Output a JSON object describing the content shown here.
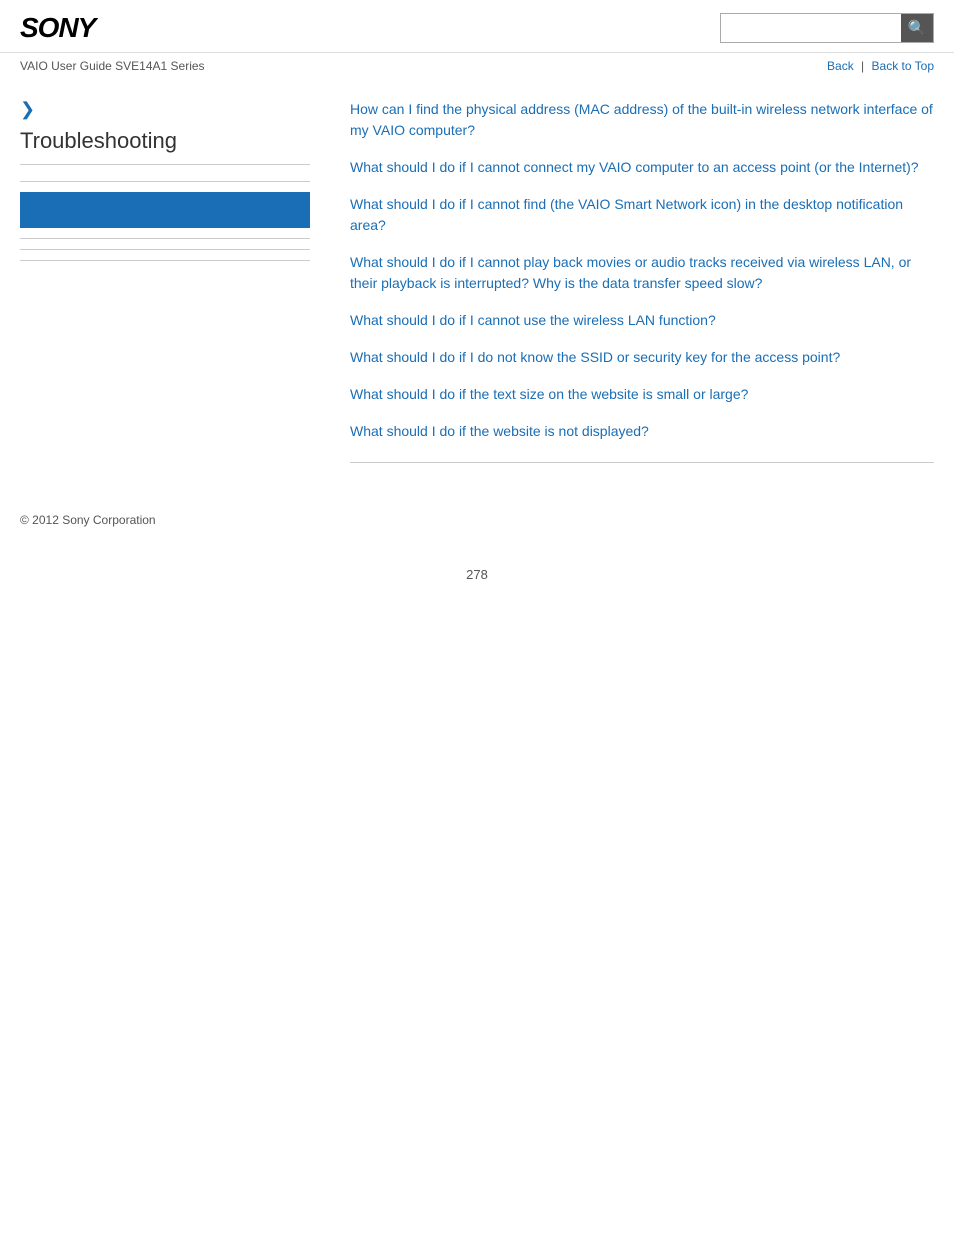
{
  "header": {
    "logo": "SONY",
    "search_placeholder": "",
    "search_icon": "🔍"
  },
  "subheader": {
    "guide_title": "VAIO User Guide SVE14A1 Series",
    "nav": {
      "back_label": "Back",
      "separator": "|",
      "back_to_top_label": "Back to Top"
    }
  },
  "sidebar": {
    "chevron": "❯",
    "title": "Troubleshooting"
  },
  "content": {
    "links": [
      "How can I find the physical address (MAC address) of the built-in wireless network interface of my VAIO computer?",
      "What should I do if I cannot connect my VAIO computer to an access point (or the Internet)?",
      "What should I do if I cannot find (the VAIO Smart Network icon) in the desktop notification area?",
      "What should I do if I cannot play back movies or audio tracks received via wireless LAN, or their playback is interrupted? Why is the data transfer speed slow?",
      "What should I do if I cannot use the wireless LAN function?",
      "What should I do if I do not know the SSID or security key for the access point?",
      "What should I do if the text size on the website is small or large?",
      "What should I do if the website is not displayed?"
    ]
  },
  "footer": {
    "copyright": "© 2012 Sony Corporation"
  },
  "page_number": "278"
}
